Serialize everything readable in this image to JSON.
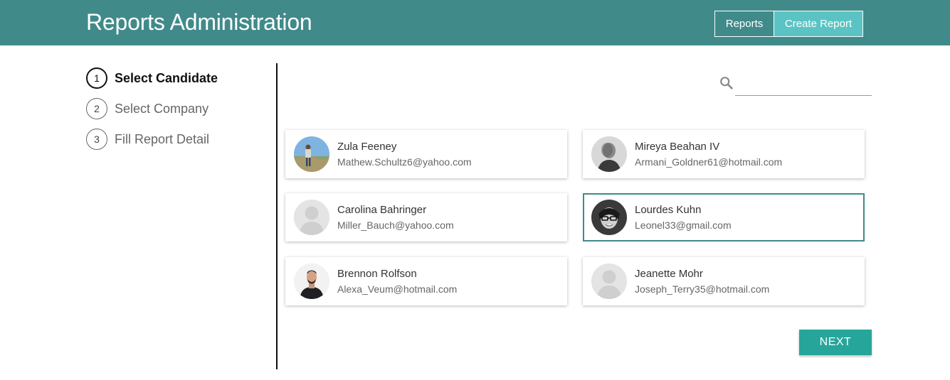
{
  "header": {
    "title": "Reports Administration",
    "nav": [
      {
        "label": "Reports"
      },
      {
        "label": "Create Report"
      }
    ]
  },
  "steps": [
    {
      "number": "1",
      "label": "Select Candidate",
      "active": true
    },
    {
      "number": "2",
      "label": "Select Company",
      "active": false
    },
    {
      "number": "3",
      "label": "Fill Report Detail",
      "active": false
    }
  ],
  "search": {
    "placeholder": "",
    "value": ""
  },
  "candidates": [
    {
      "name": "Zula Feeney",
      "email": "Mathew.Schultz6@yahoo.com",
      "avatar": "photo-outdoor-icon",
      "selected": false
    },
    {
      "name": "Mireya Beahan IV",
      "email": "Armani_Goldner61@hotmail.com",
      "avatar": "photo-blurred-icon",
      "selected": false
    },
    {
      "name": "Carolina Bahringer",
      "email": "Miller_Bauch@yahoo.com",
      "avatar": "default-avatar-icon",
      "selected": false
    },
    {
      "name": "Lourdes Kuhn",
      "email": "Leonel33@gmail.com",
      "avatar": "photo-glasses-icon",
      "selected": true
    },
    {
      "name": "Brennon Rolfson",
      "email": "Alexa_Veum@hotmail.com",
      "avatar": "photo-man-icon",
      "selected": false
    },
    {
      "name": "Jeanette Mohr",
      "email": "Joseph_Terry35@hotmail.com",
      "avatar": "default-avatar-icon",
      "selected": false
    }
  ],
  "next_label": "NEXT",
  "colors": {
    "header": "#418a8a",
    "active_nav": "#5bc3c3",
    "next_button": "#26a69a",
    "selected_border": "#418a8a"
  }
}
